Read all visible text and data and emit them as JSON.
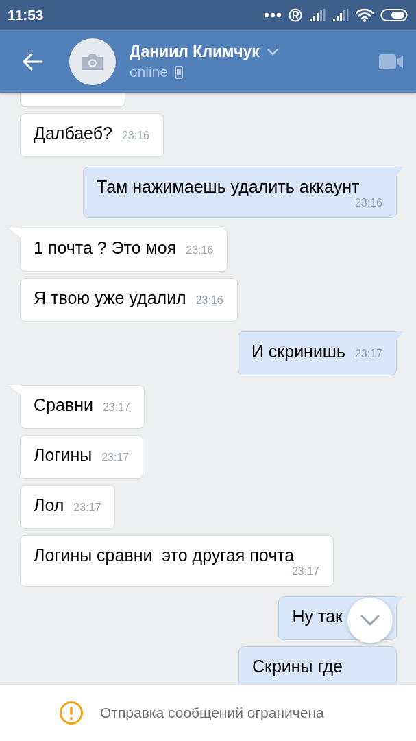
{
  "status_bar": {
    "time": "11:53"
  },
  "header": {
    "name": "Даниил Климчук",
    "status": "online"
  },
  "messages": [
    {
      "kind": "incoming",
      "tail": false,
      "text": "Далбаеб?",
      "time": "23:16"
    },
    {
      "kind": "outgoing",
      "tail": true,
      "text": "Там нажимаешь удалить аккаунт",
      "time": "23:16"
    },
    {
      "kind": "incoming",
      "tail": true,
      "text": "1 почта ? Это моя",
      "time": "23:16"
    },
    {
      "kind": "incoming",
      "tail": false,
      "text": "Я твою уже удалил",
      "time": "23:16"
    },
    {
      "kind": "outgoing",
      "tail": true,
      "text": "И скринишь",
      "time": "23:17"
    },
    {
      "kind": "incoming",
      "tail": true,
      "text": "Сравни",
      "time": "23:17"
    },
    {
      "kind": "incoming",
      "tail": false,
      "text": "Логины",
      "time": "23:17"
    },
    {
      "kind": "incoming",
      "tail": false,
      "text": "Лол",
      "time": "23:17"
    },
    {
      "kind": "incoming",
      "tail": false,
      "text": "Логины сравни  это другая почта",
      "time": "23:17"
    },
    {
      "kind": "outgoing",
      "tail": true,
      "text": "Ну так"
    },
    {
      "kind": "outgoing",
      "tail": false,
      "text": "Скрины где"
    }
  ],
  "notice": {
    "text": "Отправка сообщений ограничена"
  }
}
